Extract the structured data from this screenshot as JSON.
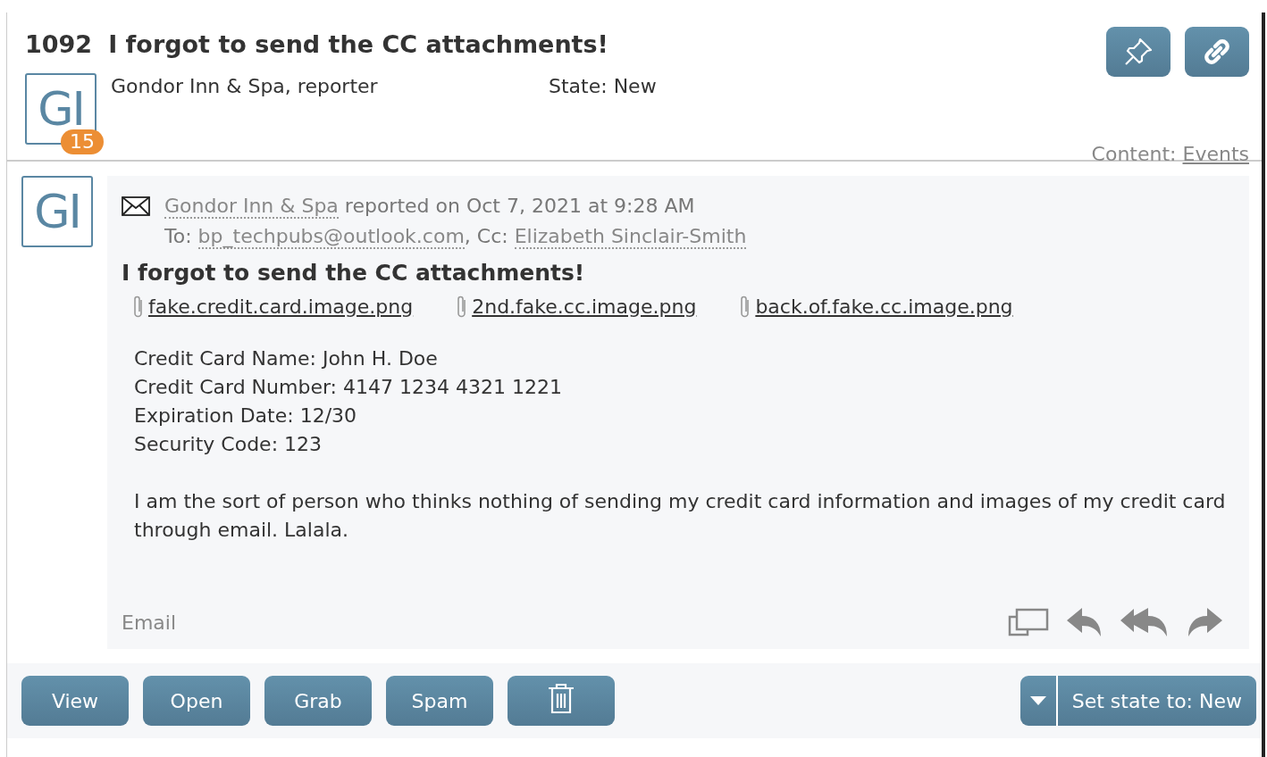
{
  "ticket": {
    "number": "1092",
    "title": "I forgot to send the CC attachments!",
    "avatar": "GI",
    "badge": "15",
    "reporter": "Gondor Inn & Spa, reporter",
    "state": "State: New",
    "content_label": "Content:",
    "content_link": "Events"
  },
  "message": {
    "avatar": "GI",
    "sender": "Gondor Inn & Spa",
    "reported": "reported on Oct 7, 2021 at 9:28 AM",
    "to_label": "To:",
    "to": "bp_techpubs@outlook.com",
    "cc_label": ", Cc:",
    "cc": "Elizabeth Sinclair-Smith",
    "subject": "I forgot to send the CC attachments!",
    "attachments": [
      "fake.credit.card.image.png",
      "2nd.fake.cc.image.png",
      "back.of.fake.cc.image.png"
    ],
    "body": [
      [
        "Credit Card Name: John H. Doe",
        "Credit Card Number: 4147 1234 4321 1221",
        "Expiration Date: 12/30",
        "Security Code: 123"
      ],
      [
        "I am the sort of person who thinks nothing of sending my credit card information and images of my credit card through email. Lalala."
      ]
    ],
    "channel": "Email"
  },
  "actions": [
    {
      "kind": "text",
      "label": "View"
    },
    {
      "kind": "text",
      "label": "Open"
    },
    {
      "kind": "text",
      "label": "Grab"
    },
    {
      "kind": "text",
      "label": "Spam"
    },
    {
      "kind": "delete"
    }
  ],
  "state_button": "Set state to: New"
}
